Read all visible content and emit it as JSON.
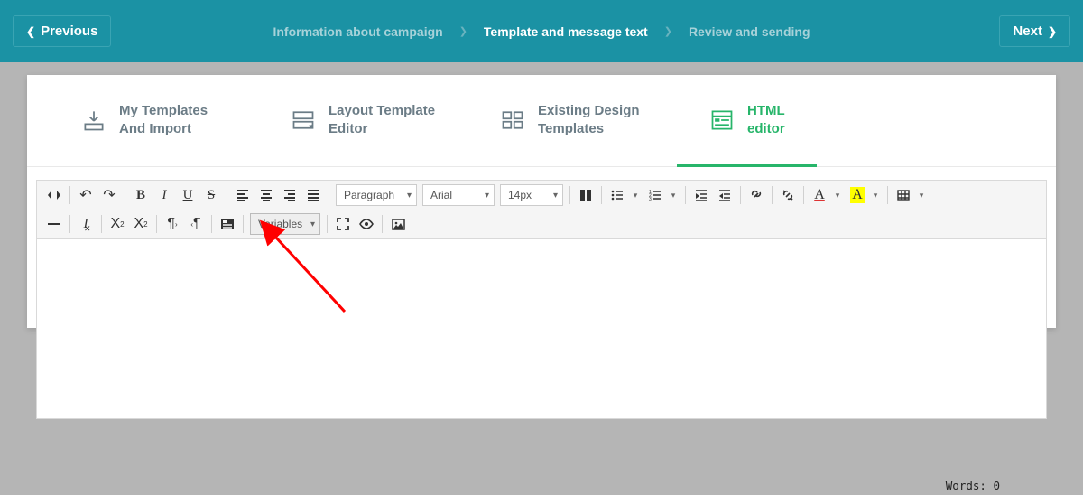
{
  "topbar": {
    "prev_label": "Previous",
    "next_label": "Next",
    "steps": [
      "Information about campaign",
      "Template and message text",
      "Review and sending"
    ],
    "active_step_index": 1
  },
  "tabs": [
    {
      "label": "My Templates And Import",
      "icon": "download-box-icon"
    },
    {
      "label": "Layout Template Editor",
      "icon": "layout-editor-icon"
    },
    {
      "label": "Existing Design Templates",
      "icon": "grid-columns-icon"
    },
    {
      "label": "HTML editor",
      "icon": "html-editor-icon"
    }
  ],
  "active_tab_index": 3,
  "toolbar": {
    "paragraph": "Paragraph",
    "font": "Arial",
    "size": "14px",
    "variables": "Variables"
  },
  "status": {
    "words_label": "Words:",
    "words_count": "0"
  },
  "colors": {
    "teal": "#1b92a4",
    "green": "#27b56a",
    "muted": "#6b7c86",
    "arrow": "#ff0000"
  }
}
